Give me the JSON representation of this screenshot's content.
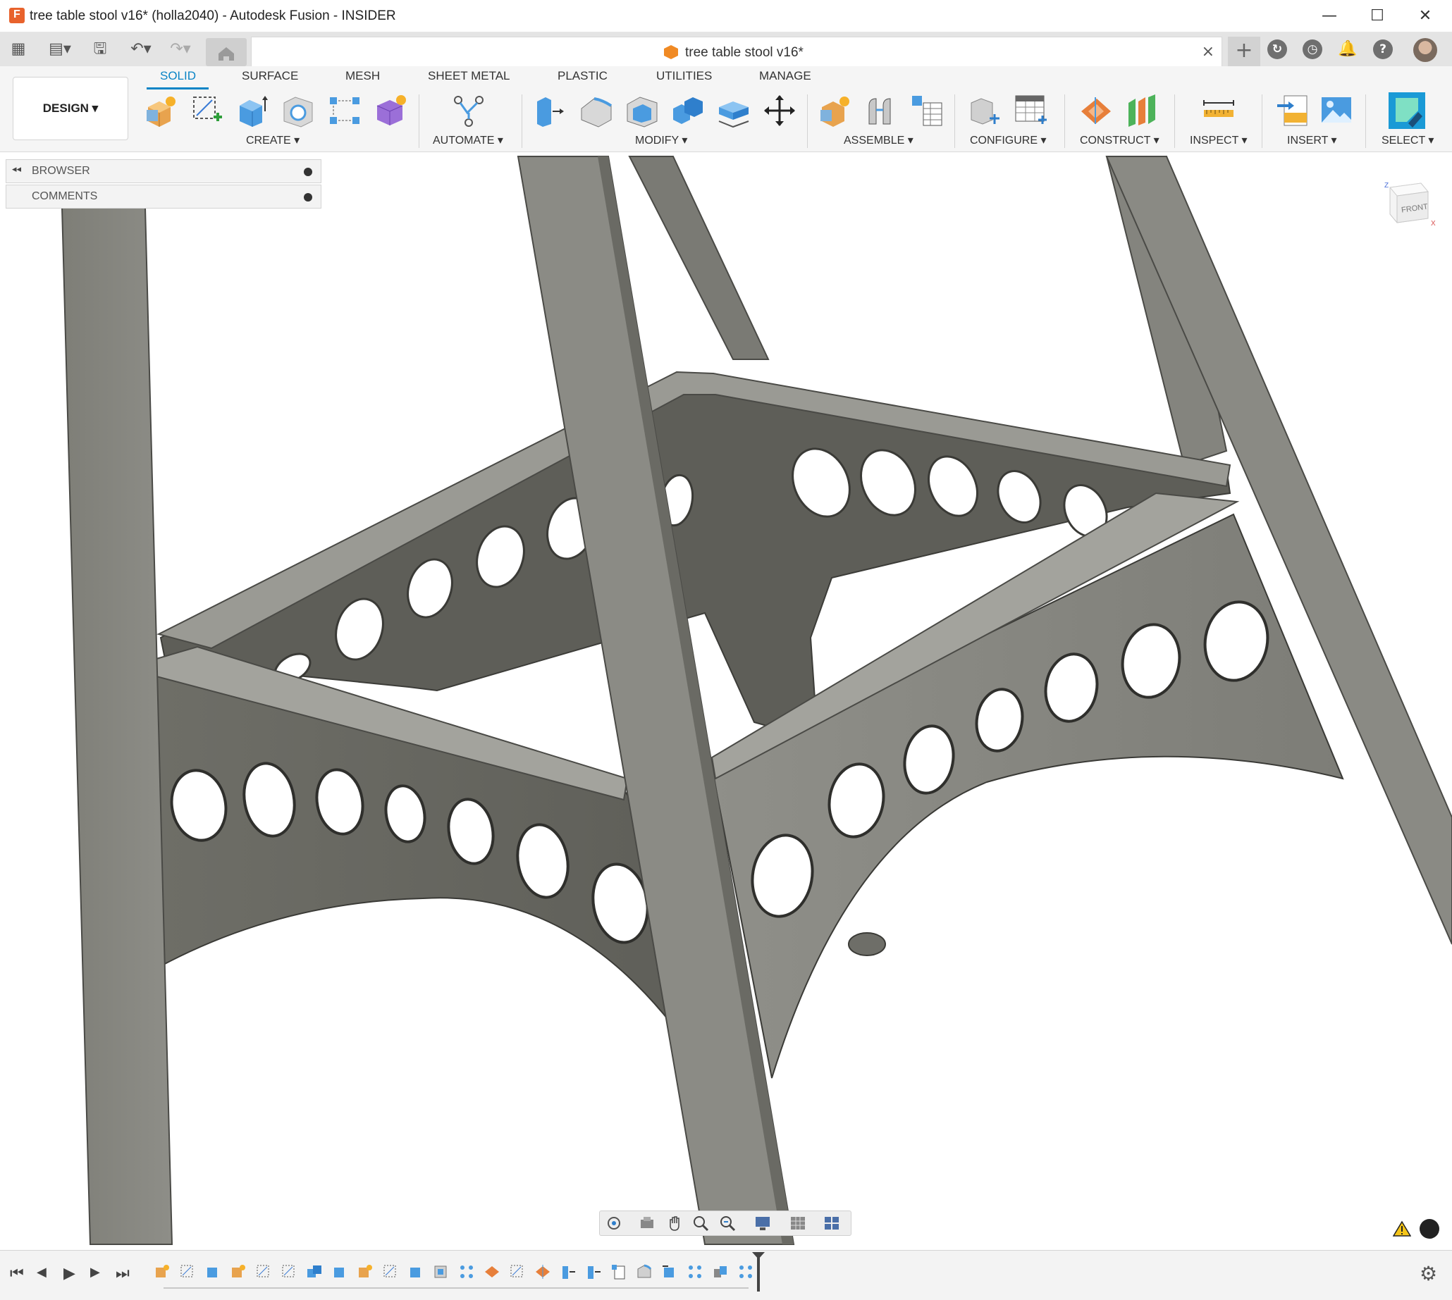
{
  "window": {
    "title": "tree table stool v16* (holla2040) - Autodesk Fusion - INSIDER",
    "minimize": "—",
    "maximize": "☐",
    "close": "✕"
  },
  "tabs": {
    "document_title": "tree table stool v16*",
    "close": "×",
    "add": "+"
  },
  "quick_access": {
    "grid": "▦",
    "file": "▤▾",
    "save": "🖫",
    "undo": "↶▾",
    "redo": "↷▾"
  },
  "header_icons": {
    "jobs": "↻",
    "history": "◷",
    "notifications": "🔔",
    "help": "?"
  },
  "workspace": {
    "label": "DESIGN ▾"
  },
  "ribbon_tabs": [
    "SOLID",
    "SURFACE",
    "MESH",
    "SHEET METAL",
    "PLASTIC",
    "UTILITIES",
    "MANAGE"
  ],
  "ribbon_groups": [
    "CREATE ▾",
    "AUTOMATE ▾",
    "MODIFY ▾",
    "ASSEMBLE ▾",
    "CONFIGURE ▾",
    "CONSTRUCT ▾",
    "INSPECT ▾",
    "INSERT ▾",
    "SELECT ▾"
  ],
  "panels": {
    "browser": "BROWSER",
    "comments": "COMMENTS",
    "collapse": "◂◂"
  },
  "viewcube": {
    "face": "FRONT",
    "axis_x": "X",
    "axis_z": "Z"
  },
  "timeline": {
    "first": "⏮",
    "prev": "◀",
    "play": "▶",
    "next": "▶",
    "last": "⏭",
    "settings": "⚙"
  },
  "colors": {
    "accent": "#0a84c6",
    "model_face": "#8a8a84",
    "model_edge": "#4a4a46"
  }
}
